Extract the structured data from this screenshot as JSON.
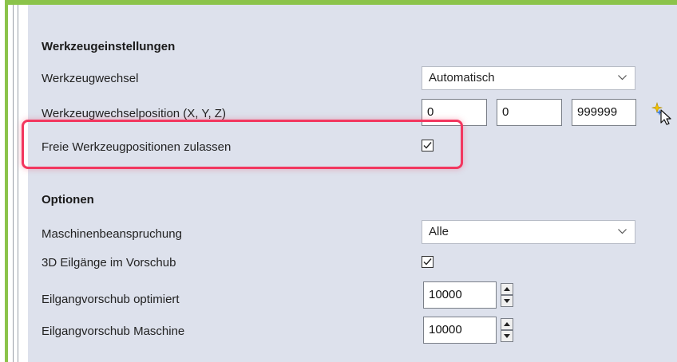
{
  "tool_settings": {
    "heading": "Werkzeugeinstellungen",
    "tool_change_label": "Werkzeugwechsel",
    "tool_change_value": "Automatisch",
    "tool_change_position_label": "Werkzeugwechselposition (X, Y, Z)",
    "position_x": "0",
    "position_y": "0",
    "position_z": "999999",
    "free_positions_label": "Freie Werkzeugpositionen zulassen",
    "free_positions_checked": true
  },
  "options": {
    "heading": "Optionen",
    "machine_load_label": "Maschinenbeanspruchung",
    "machine_load_value": "Alle",
    "rapid_in_feed_label": "3D Eilgänge im Vorschub",
    "rapid_in_feed_checked": true,
    "rapid_feed_optimized_label": "Eilgangvorschub optimiert",
    "rapid_feed_optimized_value": "10000",
    "rapid_feed_machine_label": "Eilgangvorschub Maschine",
    "rapid_feed_machine_value": "10000"
  },
  "colors": {
    "frame_green": "#8bc34a",
    "panel_bg": "#dde1ec",
    "highlight": "#f2375f"
  },
  "icons": {
    "pick_position": "magic-wand-cursor-icon"
  }
}
